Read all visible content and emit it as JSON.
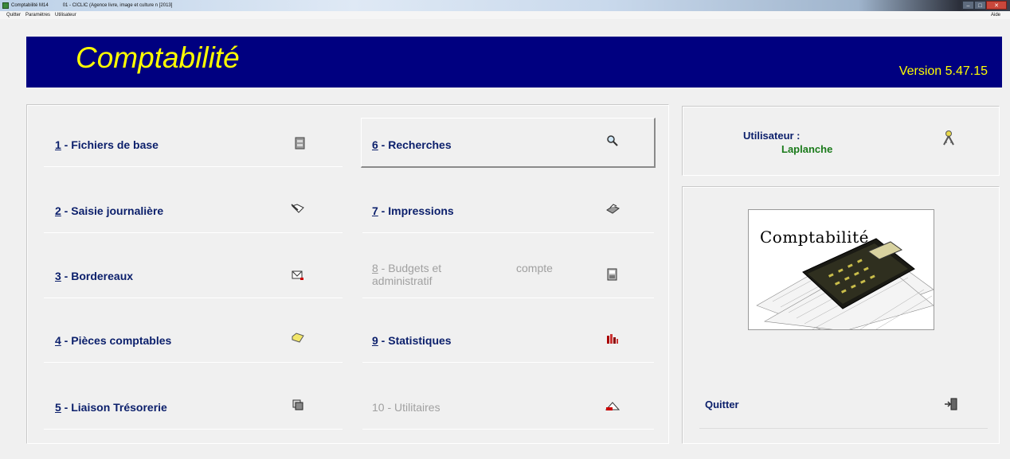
{
  "window": {
    "app_name": "Comptabilité M14",
    "document": "01 - CICLIC (Agence livre, image et culture n  [2013]"
  },
  "menubar": {
    "items": [
      "Quitter",
      "Paramètres",
      "Utilisateur"
    ],
    "help": "Aide"
  },
  "banner": {
    "title": "Comptabilité",
    "version": "Version 5.47.15"
  },
  "menu": {
    "items": [
      {
        "num": "1",
        "rest": " - Fichiers de base",
        "icon": "file-cabinet-icon",
        "enabled": true
      },
      {
        "num": "2",
        "rest": " - Saisie journalière",
        "icon": "pen-entry-icon",
        "enabled": true
      },
      {
        "num": "3",
        "rest": " - Bordereaux",
        "icon": "envelope-icon",
        "enabled": true
      },
      {
        "num": "4",
        "rest": " - Pièces comptables",
        "icon": "folder-icon",
        "enabled": true
      },
      {
        "num": "5",
        "rest": " - Liaison Trésorerie",
        "icon": "documents-icon",
        "enabled": true
      },
      {
        "num": "6",
        "rest": " - Recherches",
        "icon": "search-icon",
        "enabled": true
      },
      {
        "num": "7",
        "rest": " - Impressions",
        "icon": "printer-icon",
        "enabled": true
      },
      {
        "num": "8",
        "rest": " - Budgets et",
        "rest2": "compte",
        "line2": "administratif",
        "icon": "ledger-icon",
        "enabled": false
      },
      {
        "num": "9",
        "rest": " - Statistiques",
        "icon": "bar-chart-icon",
        "enabled": true
      },
      {
        "num": "10",
        "rest": " - Utilitaires",
        "icon": "tools-icon",
        "enabled": false
      }
    ]
  },
  "user": {
    "label": "Utilisateur :",
    "name": "Laplanche",
    "icon": "keys-icon"
  },
  "logo": {
    "text": "Comptabilité",
    "icon": "calculator-icon"
  },
  "quit": {
    "label": "Quitter",
    "icon": "exit-door-icon"
  }
}
